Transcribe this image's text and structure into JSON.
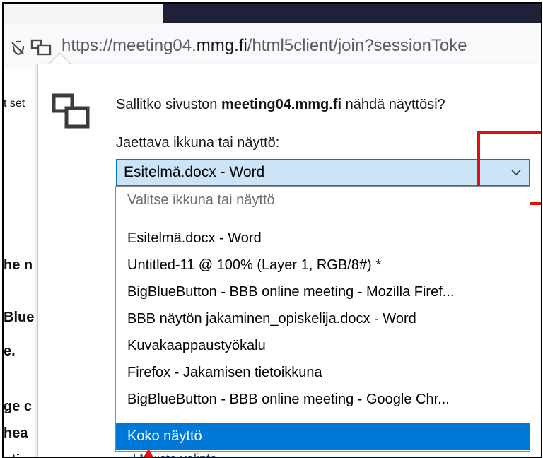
{
  "browser": {
    "url_prefix": "https://meeting04.",
    "url_domain": "mmg.fi",
    "url_rest": "/html5client/join?sessionToke"
  },
  "background_page": {
    "tab_fragment": "t set",
    "text_lines": [
      "he n",
      "Blue",
      "e.",
      "ge c",
      "hea",
      "ati"
    ]
  },
  "prompt": {
    "question_pre": "Sallitko sivuston ",
    "question_site": "meeting04.mmg.fi",
    "question_post": " nähdä näyttösi?",
    "select_label": "Jaettava ikkuna tai näyttö:",
    "selected_value": "Esitelmä.docx - Word"
  },
  "dropdown": {
    "placeholder": "Valitse ikkuna tai näyttö",
    "options": [
      "Esitelmä.docx - Word",
      "Untitled-11 @ 100% (Layer 1, RGB/8#) *",
      "BigBlueButton - BBB online meeting - Mozilla Firef...",
      "BBB näytön jakaminen_opiskelija.docx - Word",
      "Kuvakaappaustyökalu",
      "Firefox - Jakamisen tietoikkuna",
      "BigBlueButton - BBB online meeting - Google Chr...",
      "Koko näyttö"
    ],
    "highlighted": "Koko näyttö"
  },
  "checkbox": {
    "label": "Muista valinta"
  },
  "colors": {
    "highlight": "#0078d7",
    "select_bg": "#cce4f7",
    "annotation": "#e01010",
    "toolbar_dark": "#1f2138"
  },
  "icons": [
    "permissions-icon",
    "screen-share-icon",
    "chevron-down-icon"
  ]
}
